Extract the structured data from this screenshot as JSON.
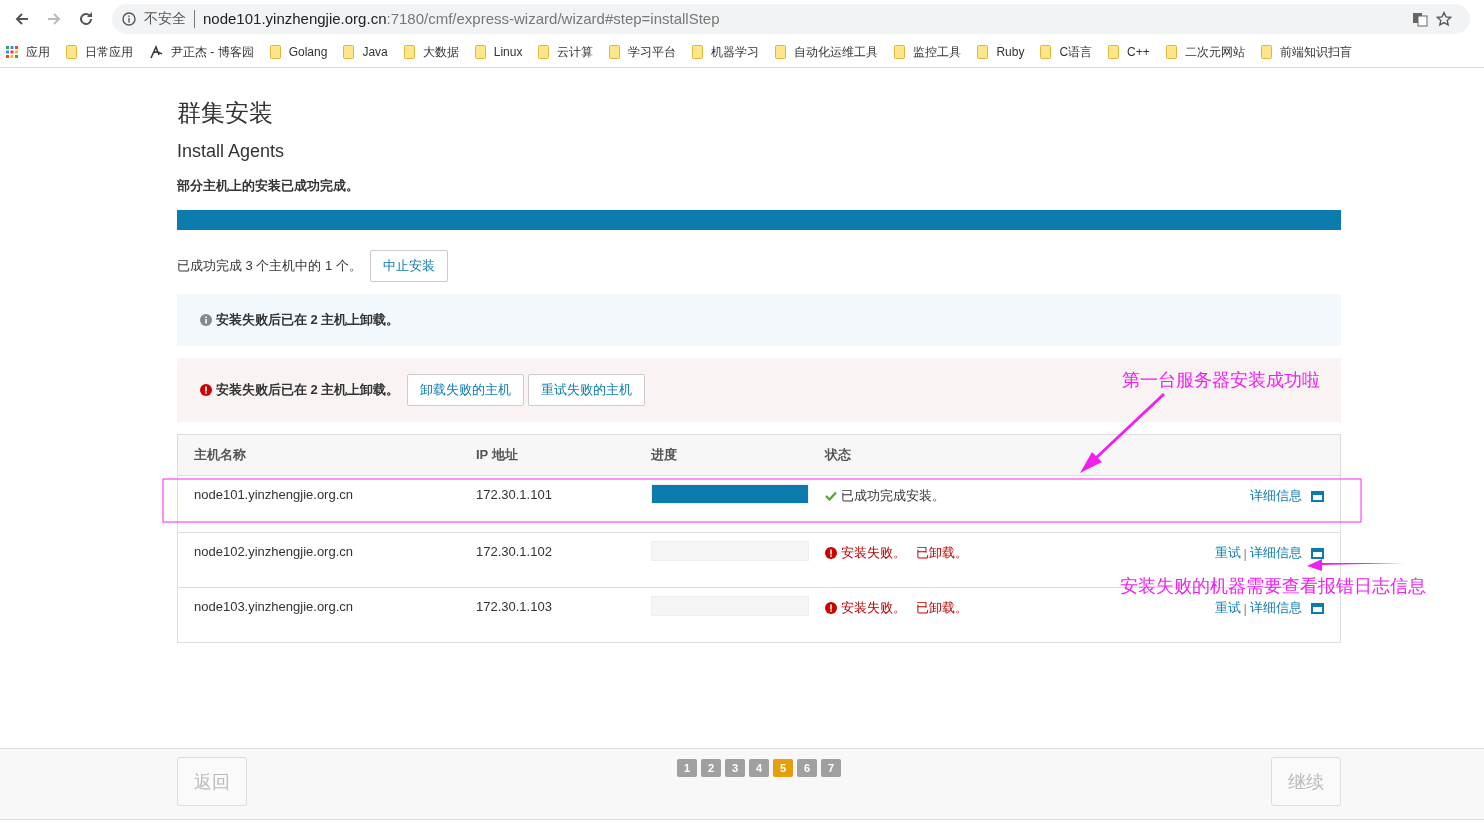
{
  "browser": {
    "security": "不安全",
    "url_host": "node101.yinzhengjie.org.cn",
    "url_path": ":7180/cmf/express-wizard/wizard#step=installStep",
    "bookmarks": [
      {
        "label": "应用",
        "kind": "apps"
      },
      {
        "label": "日常应用",
        "kind": "folder"
      },
      {
        "label": "尹正杰 - 博客园",
        "kind": "site"
      },
      {
        "label": "Golang",
        "kind": "folder"
      },
      {
        "label": "Java",
        "kind": "folder"
      },
      {
        "label": "大数据",
        "kind": "folder"
      },
      {
        "label": "Linux",
        "kind": "folder"
      },
      {
        "label": "云计算",
        "kind": "folder"
      },
      {
        "label": "学习平台",
        "kind": "folder"
      },
      {
        "label": "机器学习",
        "kind": "folder"
      },
      {
        "label": "自动化运维工具",
        "kind": "folder"
      },
      {
        "label": "监控工具",
        "kind": "folder"
      },
      {
        "label": "Ruby",
        "kind": "folder"
      },
      {
        "label": "C语言",
        "kind": "folder"
      },
      {
        "label": "C++",
        "kind": "folder"
      },
      {
        "label": "二次元网站",
        "kind": "folder"
      },
      {
        "label": "前端知识扫盲",
        "kind": "folder"
      }
    ]
  },
  "page": {
    "title": "群集安装",
    "subtitle": "Install Agents",
    "status": "部分主机上的安装已成功完成。",
    "progress": {
      "level": 1
    },
    "summary": "已成功完成 3 个主机中的 1 个。",
    "abort_button": "中止安装",
    "alerts": [
      {
        "kind": "info",
        "text": "安装失败后已在 2 主机上卸载。"
      },
      {
        "kind": "error",
        "text": "安装失败后已在 2 主机上卸载。",
        "buttons": [
          "卸载失败的主机",
          "重试失败的主机"
        ]
      }
    ],
    "table": {
      "columns": [
        "主机名称",
        "IP 地址",
        "进度",
        "状态"
      ],
      "rows": [
        {
          "host": "node101.yinzhengjie.org.cn",
          "ip": "172.30.1.101",
          "level": 1,
          "kind": "success",
          "status": [
            "已成功完成安装。"
          ],
          "details": "详细信息"
        },
        {
          "host": "node102.yinzhengjie.org.cn",
          "ip": "172.30.1.102",
          "level": 0,
          "kind": "failed",
          "status": [
            "安装失败。",
            "已卸载。"
          ],
          "retry": "重试",
          "separator": "|",
          "details": "详细信息"
        },
        {
          "host": "node103.yinzhengjie.org.cn",
          "ip": "172.30.1.103",
          "level": 0,
          "kind": "failed",
          "status": [
            "安装失败。",
            "已卸载。"
          ],
          "retry": "重试",
          "separator": "|",
          "details": "详细信息"
        }
      ]
    }
  },
  "footer": {
    "back": {
      "label": "返回",
      "disabled": true
    },
    "next": {
      "label": "继续",
      "disabled": true
    },
    "steps": [
      {
        "label": "1",
        "selected": false
      },
      {
        "label": "2",
        "selected": false
      },
      {
        "label": "3",
        "selected": false
      },
      {
        "label": "4",
        "selected": false
      },
      {
        "label": "5",
        "selected": true
      },
      {
        "label": "6",
        "selected": false
      },
      {
        "label": "7",
        "selected": false
      }
    ]
  },
  "annotations": [
    {
      "text": "第一台服务器安装成功啦"
    },
    {
      "text": "安装失败的机器需要查看报错日志信息"
    }
  ]
}
